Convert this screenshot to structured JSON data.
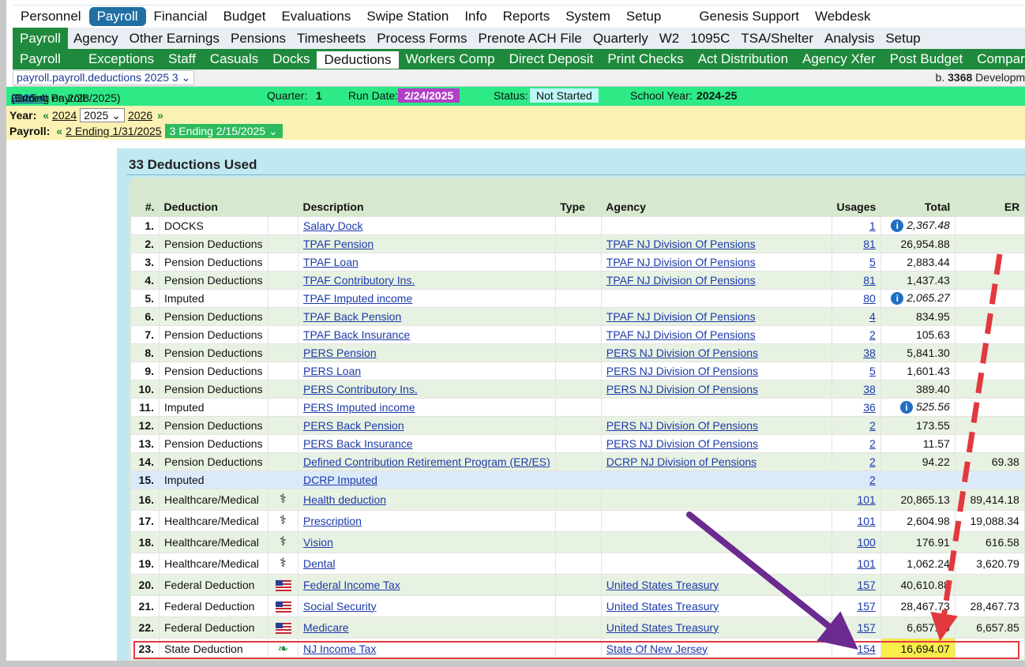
{
  "top_nav": [
    "Personnel",
    "Payroll",
    "Financial",
    "Budget",
    "Evaluations",
    "Swipe Station",
    "Info",
    "Reports",
    "System",
    "Setup",
    "Genesis Support",
    "Webdesk"
  ],
  "top_nav_active": "Payroll",
  "sub_nav": [
    "Payroll",
    "Agency",
    "Other Earnings",
    "Pensions",
    "Timesheets",
    "Process Forms",
    "Prenote ACH File",
    "Quarterly",
    "W2",
    "1095C",
    "TSA/Shelter",
    "Analysis",
    "Setup"
  ],
  "sub_nav_active": "Payroll",
  "tabs": [
    "Payroll",
    "Exceptions",
    "Staff",
    "Casuals",
    "Docks",
    "Deductions",
    "Workers Comp",
    "Direct Deposit",
    "Print Checks",
    "Act Distribution",
    "Agency Xfer",
    "Post Budget",
    "Compare"
  ],
  "tabs_active": "Deductions",
  "screen_selector": "payroll.payroll.deductions 2025 3",
  "build": {
    "prefix": "b.",
    "number": "3368",
    "suffix": "Developme"
  },
  "current": {
    "label": "Current Payroll:",
    "payroll": "2025-4",
    "ending": "(Ending on 2/28/2025)",
    "quarter_label": "Quarter:",
    "quarter": "1",
    "run_date_label": "Run Date:",
    "run_date": "2/24/2025",
    "status_label": "Status:",
    "status": "Not Started",
    "school_year_label": "School Year:",
    "school_year": "2024-25"
  },
  "year": {
    "label": "Year:",
    "prev": "2024",
    "selected": "2025",
    "next": "2026"
  },
  "payroll_pick": {
    "label": "Payroll:",
    "prev": "2 Ending 1/31/2025",
    "selected": "3 Ending 2/15/2025"
  },
  "panel_title": "33 Deductions Used",
  "columns": [
    "#.",
    "Deduction",
    "",
    "Description",
    "Type",
    "Agency",
    "Usages",
    "Total",
    "ER"
  ],
  "rows": [
    {
      "n": "1.",
      "deduction": "DOCKS",
      "icon": "",
      "description": "Salary Dock",
      "type": "",
      "agency": "",
      "usages": "1",
      "total": "2,367.48",
      "total_info": true,
      "er": ""
    },
    {
      "n": "2.",
      "deduction": "Pension Deductions",
      "icon": "",
      "description": "TPAF Pension",
      "type": "",
      "agency": "TPAF NJ Division Of Pensions",
      "usages": "81",
      "total": "26,954.88",
      "total_info": false,
      "er": ""
    },
    {
      "n": "3.",
      "deduction": "Pension Deductions",
      "icon": "",
      "description": "TPAF Loan",
      "type": "",
      "agency": "TPAF NJ Division Of Pensions",
      "usages": "5",
      "total": "2,883.44",
      "total_info": false,
      "er": ""
    },
    {
      "n": "4.",
      "deduction": "Pension Deductions",
      "icon": "",
      "description": "TPAF Contributory Ins.",
      "type": "",
      "agency": "TPAF NJ Division Of Pensions",
      "usages": "81",
      "total": "1,437.43",
      "total_info": false,
      "er": ""
    },
    {
      "n": "5.",
      "deduction": "Imputed",
      "icon": "",
      "description": "TPAF Imputed income",
      "type": "",
      "agency": "",
      "usages": "80",
      "total": "2,065.27",
      "total_info": true,
      "er": ""
    },
    {
      "n": "6.",
      "deduction": "Pension Deductions",
      "icon": "",
      "description": "TPAF Back Pension",
      "type": "",
      "agency": "TPAF NJ Division Of Pensions",
      "usages": "4",
      "total": "834.95",
      "total_info": false,
      "er": ""
    },
    {
      "n": "7.",
      "deduction": "Pension Deductions",
      "icon": "",
      "description": "TPAF Back Insurance",
      "type": "",
      "agency": "TPAF NJ Division Of Pensions",
      "usages": "2",
      "total": "105.63",
      "total_info": false,
      "er": ""
    },
    {
      "n": "8.",
      "deduction": "Pension Deductions",
      "icon": "",
      "description": "PERS Pension",
      "type": "",
      "agency": "PERS NJ Division Of Pensions",
      "usages": "38",
      "total": "5,841.30",
      "total_info": false,
      "er": ""
    },
    {
      "n": "9.",
      "deduction": "Pension Deductions",
      "icon": "",
      "description": "PERS Loan",
      "type": "",
      "agency": "PERS NJ Division Of Pensions",
      "usages": "5",
      "total": "1,601.43",
      "total_info": false,
      "er": ""
    },
    {
      "n": "10.",
      "deduction": "Pension Deductions",
      "icon": "",
      "description": "PERS Contributory Ins.",
      "type": "",
      "agency": "PERS NJ Division Of Pensions",
      "usages": "38",
      "total": "389.40",
      "total_info": false,
      "er": ""
    },
    {
      "n": "11.",
      "deduction": "Imputed",
      "icon": "",
      "description": "PERS Imputed income",
      "type": "",
      "agency": "",
      "usages": "36",
      "total": "525.56",
      "total_info": true,
      "er": ""
    },
    {
      "n": "12.",
      "deduction": "Pension Deductions",
      "icon": "",
      "description": "PERS Back Pension",
      "type": "",
      "agency": "PERS NJ Division Of Pensions",
      "usages": "2",
      "total": "173.55",
      "total_info": false,
      "er": ""
    },
    {
      "n": "13.",
      "deduction": "Pension Deductions",
      "icon": "",
      "description": "PERS Back Insurance",
      "type": "",
      "agency": "PERS NJ Division Of Pensions",
      "usages": "2",
      "total": "11.57",
      "total_info": false,
      "er": ""
    },
    {
      "n": "14.",
      "deduction": "Pension Deductions",
      "icon": "",
      "description": "Defined Contribution Retirement Program (ER/ES)",
      "type": "",
      "agency": "DCRP NJ Division of Pensions",
      "usages": "2",
      "total": "94.22",
      "total_info": false,
      "er": "69.38"
    },
    {
      "n": "15.",
      "deduction": "Imputed",
      "icon": "",
      "description": "DCRP Imputed",
      "type": "",
      "agency": "",
      "usages": "2",
      "total": "",
      "total_info": false,
      "er": ""
    },
    {
      "n": "16.",
      "deduction": "Healthcare/Medical",
      "icon": "caduceus-icon",
      "description": "Health deduction",
      "type": "",
      "agency": "",
      "usages": "101",
      "total": "20,865.13",
      "total_info": false,
      "er": "89,414.18"
    },
    {
      "n": "17.",
      "deduction": "Healthcare/Medical",
      "icon": "caduceus-icon",
      "description": "Prescription",
      "type": "",
      "agency": "",
      "usages": "101",
      "total": "2,604.98",
      "total_info": false,
      "er": "19,088.34"
    },
    {
      "n": "18.",
      "deduction": "Healthcare/Medical",
      "icon": "caduceus-icon",
      "description": "Vision",
      "type": "",
      "agency": "",
      "usages": "100",
      "total": "176.91",
      "total_info": false,
      "er": "616.58"
    },
    {
      "n": "19.",
      "deduction": "Healthcare/Medical",
      "icon": "caduceus-icon",
      "description": "Dental",
      "type": "",
      "agency": "",
      "usages": "101",
      "total": "1,062.24",
      "total_info": false,
      "er": "3,620.79"
    },
    {
      "n": "20.",
      "deduction": "Federal Deduction",
      "icon": "us-flag-icon",
      "description": "Federal Income Tax",
      "type": "",
      "agency": "United States Treasury",
      "usages": "157",
      "total": "40,610.88",
      "total_info": false,
      "er": ""
    },
    {
      "n": "21.",
      "deduction": "Federal Deduction",
      "icon": "us-flag-icon",
      "description": "Social Security",
      "type": "",
      "agency": "United States Treasury",
      "usages": "157",
      "total": "28,467.73",
      "total_info": false,
      "er": "28,467.73"
    },
    {
      "n": "22.",
      "deduction": "Federal Deduction",
      "icon": "us-flag-icon",
      "description": "Medicare",
      "type": "",
      "agency": "United States Treasury",
      "usages": "157",
      "total": "6,657.85",
      "total_info": false,
      "er": "6,657.85"
    },
    {
      "n": "23.",
      "deduction": "State Deduction",
      "icon": "nj-state-icon",
      "description": "NJ Income Tax",
      "type": "",
      "agency": "State Of New Jersey",
      "usages": "154",
      "total": "16,694.07",
      "total_info": false,
      "er": ""
    }
  ],
  "highlight_row": "23.",
  "colors": {
    "tab_green": "#1f8a3d",
    "nav_blue": "#1f6fa3",
    "current_bar": "#2dea86",
    "run_date": "#b13fc7",
    "year_bar": "#fbf1b3",
    "panel": "#bfe8f0",
    "annotation_red": "#e2393f",
    "annotation_purple": "#6a2a8f",
    "highlight_yellow": "#f7ee4a"
  }
}
